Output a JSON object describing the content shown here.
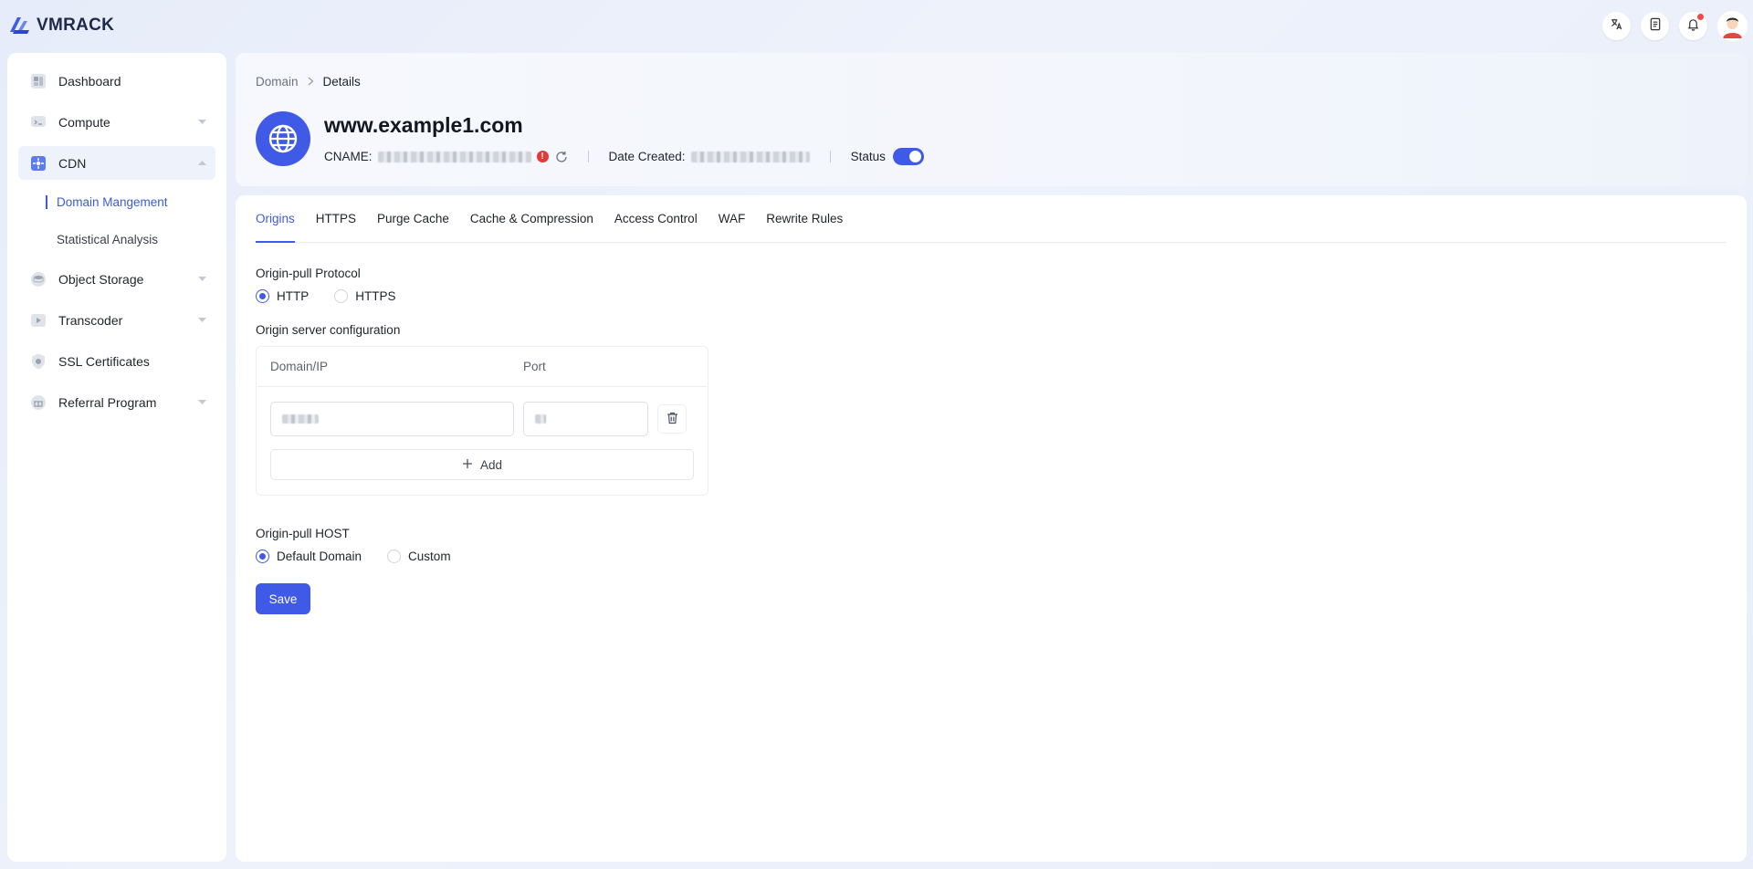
{
  "app": {
    "logo_text": "VMRACK"
  },
  "topbar": {
    "icons": [
      "translate-icon",
      "document-icon",
      "bell-icon",
      "avatar"
    ]
  },
  "sidebar": {
    "items": [
      {
        "label": "Dashboard",
        "icon": "dashboard-icon",
        "expandable": false
      },
      {
        "label": "Compute",
        "icon": "compute-icon",
        "expandable": true
      },
      {
        "label": "CDN",
        "icon": "cdn-icon",
        "expandable": true,
        "expanded": true,
        "children": [
          {
            "label": "Domain Mangement",
            "active": true
          },
          {
            "label": "Statistical Analysis",
            "active": false
          }
        ]
      },
      {
        "label": "Object Storage",
        "icon": "storage-icon",
        "expandable": true
      },
      {
        "label": "Transcoder",
        "icon": "transcoder-icon",
        "expandable": true
      },
      {
        "label": "SSL Certificates",
        "icon": "ssl-icon",
        "expandable": false
      },
      {
        "label": "Referral Program",
        "icon": "referral-icon",
        "expandable": true
      }
    ]
  },
  "header": {
    "breadcrumb": [
      "Domain",
      "Details"
    ],
    "domain": "www.example1.com",
    "cname_label": "CNAME:",
    "date_label": "Date Created:",
    "status_label": "Status",
    "status_on": true
  },
  "tabs": [
    "Origins",
    "HTTPS",
    "Purge Cache",
    "Cache & Compression",
    "Access Control",
    "WAF",
    "Rewrite Rules"
  ],
  "active_tab": "Origins",
  "origins": {
    "protocol_title": "Origin-pull Protocol",
    "protocol_options": [
      "HTTP",
      "HTTPS"
    ],
    "protocol_selected": "HTTP",
    "server_config_title": "Origin server configuration",
    "columns": [
      "Domain/IP",
      "Port"
    ],
    "add_label": "Add",
    "host_title": "Origin-pull HOST",
    "host_options": [
      "Default Domain",
      "Custom"
    ],
    "host_selected": "Default Domain",
    "save_label": "Save"
  },
  "colors": {
    "accent": "#3f5ae6",
    "warning": "#e53935"
  }
}
